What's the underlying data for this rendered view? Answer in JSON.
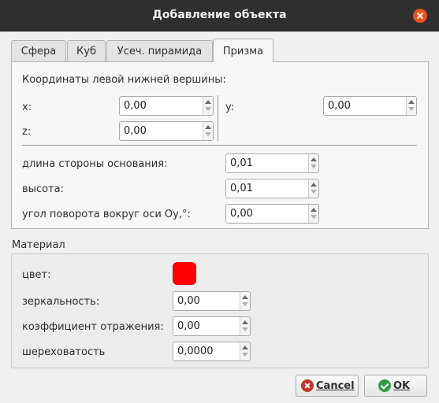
{
  "window": {
    "title": "Добавление объекта"
  },
  "tabs": [
    {
      "label": "Сфера"
    },
    {
      "label": "Куб"
    },
    {
      "label": "Усеч. пирамида"
    },
    {
      "label": "Призма",
      "active": true
    }
  ],
  "prism": {
    "coords_title": "Координаты левой нижней вершины:",
    "x_label": "x:",
    "x_value": "0,00",
    "y_label": "y:",
    "y_value": "0,00",
    "z_label": "z:",
    "z_value": "0,00",
    "base_side_label": "длина стороны основания:",
    "base_side_value": "0,01",
    "height_label": "высота:",
    "height_value": "0,01",
    "rotation_label": "угол поворота вокруг оси Oy,°:",
    "rotation_value": "0,00"
  },
  "material": {
    "title": "Материал",
    "color_label": "цвет:",
    "color_value": "#ff0000",
    "specular_label": "зеркальность:",
    "specular_value": "0,00",
    "reflection_label": "коэффициент отражения:",
    "reflection_value": "0,00",
    "roughness_label": "шереховатость",
    "roughness_value": "0,0000"
  },
  "buttons": {
    "cancel": "Cancel",
    "ok": "OK"
  }
}
